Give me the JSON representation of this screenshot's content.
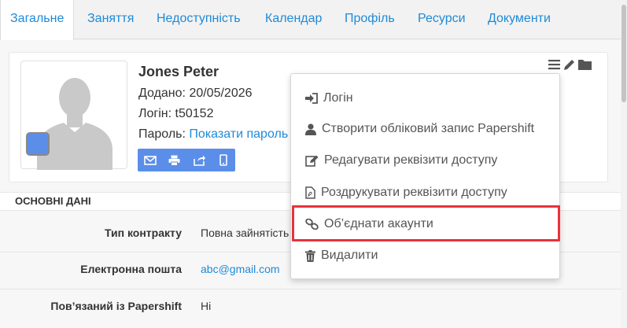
{
  "tabs": [
    {
      "label": "Загальне",
      "active": true
    },
    {
      "label": "Заняття"
    },
    {
      "label": "Недоступність"
    },
    {
      "label": "Календар"
    },
    {
      "label": "Профіль"
    },
    {
      "label": "Ресурси"
    },
    {
      "label": "Документи"
    }
  ],
  "profile": {
    "name": "Jones Peter",
    "added_label": "Додано:",
    "added_value": "20/05/2026",
    "login_label": "Логін:",
    "login_value": "t50152",
    "password_label": "Пароль:",
    "password_link": "Показати пароль"
  },
  "section": {
    "title": "ОСНОВНІ ДАНІ",
    "fields": [
      {
        "label": "Тип контракту",
        "value": "Повна зайнятість"
      },
      {
        "label": "Електронна пошта",
        "value": "abc@gmail.com"
      },
      {
        "label": "Пов’язаний із Papershift",
        "value": "Ні"
      }
    ]
  },
  "menu": {
    "items": [
      {
        "label": "Логін",
        "icon": "sign-in-icon"
      },
      {
        "label": "Створити обліковий запис Papershift",
        "icon": "user-icon"
      },
      {
        "label": "Редагувати реквізити доступу",
        "icon": "edit-icon"
      },
      {
        "label": "Роздрукувати реквізити доступу",
        "icon": "pdf-file-icon"
      },
      {
        "label": "Об’єднати акаунти",
        "icon": "link-icon",
        "highlighted": true
      },
      {
        "label": "Видалити",
        "icon": "trash-icon"
      }
    ]
  },
  "colors": {
    "accent": "#1f8ad8",
    "button_blue": "#5b8ee8",
    "highlight_red": "#e8333b"
  }
}
